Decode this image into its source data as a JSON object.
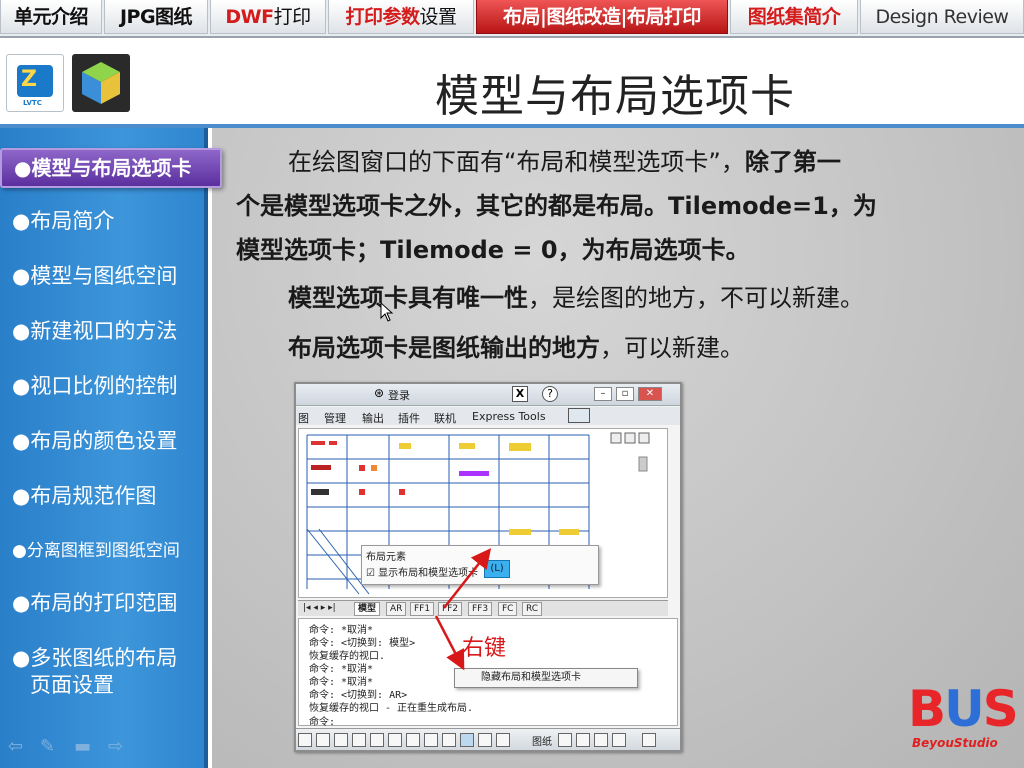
{
  "top_tabs": [
    {
      "label": "单元介绍",
      "color": "#111111",
      "active": false
    },
    {
      "label": "JPG图纸",
      "color": "#111111",
      "active": false
    },
    {
      "label_red": "DWF",
      "label_rest": "打印",
      "color": "#d41c1c",
      "active": false
    },
    {
      "label_red": "打印参数",
      "label_rest": "设置",
      "color": "#d41c1c",
      "active": false
    },
    {
      "label": "布局|图纸改造|布局打印",
      "color": "#ffffff",
      "active": true
    },
    {
      "label": "图纸集简介",
      "color": "#d41c1c",
      "active": false
    },
    {
      "label": "Design Review",
      "color": "#333333",
      "active": false
    }
  ],
  "header": {
    "title": "模型与布局选项卡",
    "logo1_text": "LVTC"
  },
  "sidebar": {
    "items": [
      {
        "label": "●模型与布局选项卡",
        "active": true
      },
      {
        "label": "●布局简介"
      },
      {
        "label": "●模型与图纸空间"
      },
      {
        "label": "●新建视口的方法"
      },
      {
        "label": "●视口比例的控制"
      },
      {
        "label": "●布局的颜色设置"
      },
      {
        "label": "●布局规范作图"
      },
      {
        "label": "●分离图框到图纸空间"
      },
      {
        "label": "●布局的打印范围"
      },
      {
        "label": "●多张图纸的布局"
      },
      {
        "label": "页面设置"
      }
    ],
    "nav_icons": [
      "back-arrow-icon",
      "pen-icon",
      "menu-icon",
      "forward-arrow-icon"
    ]
  },
  "content": {
    "p1_a": "在绘图窗口的下面有“布局和模型选项卡”，",
    "p1_b": "除了第一",
    "p1_line2": "个是模型选项卡之外，其它的都是布局。Tilemode=1，为",
    "p1_line3": "模型选项卡；Tilemode = 0，为布局选项卡。",
    "p2_bold": "模型选项卡具有唯一性",
    "p2_rest": "，是绘图的地方，不可以新建。",
    "p3_bold": "布局选项卡是图纸输出的地方",
    "p3_rest": "，可以新建。"
  },
  "screenshot": {
    "user_label": "登录",
    "menu": [
      "图",
      "管理",
      "输出",
      "插件",
      "联机",
      "Express Tools"
    ],
    "popup_header": "布局元素",
    "popup_option": "显示布局和模型选项卡",
    "popup_shortcut": "(L)",
    "layout_tabs": [
      "模型",
      "AR",
      "FF1",
      "FF2",
      "FF3",
      "FC",
      "RC"
    ],
    "cmd_lines": [
      "命令: *取消*",
      "命令:    <切换到: 模型>",
      "恢复缓存的视口.",
      "命令: *取消*",
      "命令: *取消*",
      "命令:    <切换到: AR>",
      "恢复缓存的视口 - 正在重生成布局.",
      "命令:"
    ],
    "right_click_label": "右键",
    "context_menu_item": "隐藏布局和模型选项卡",
    "status_label": "图纸"
  },
  "bus_logo": {
    "letters": [
      "B",
      "U",
      "S"
    ],
    "letter_colors": [
      "#e8262a",
      "#2d6fd6",
      "#e8262a"
    ],
    "subtitle": "BeyouStudio"
  },
  "colors": {
    "sidebar": "#3389d2",
    "active_tab": "#c41e1e",
    "active_side": "#6f44b0",
    "accent_red": "#d41c1c"
  }
}
